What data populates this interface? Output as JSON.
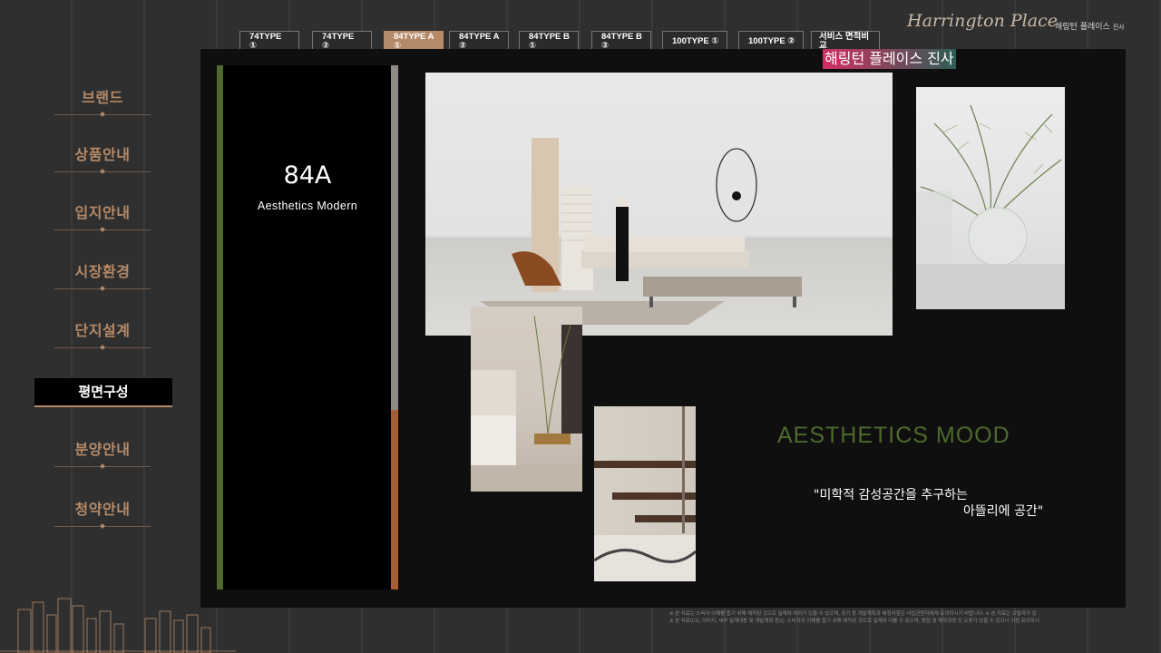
{
  "sidebar": {
    "items": [
      {
        "label": "브랜드"
      },
      {
        "label": "상품안내"
      },
      {
        "label": "입지안내"
      },
      {
        "label": "시장환경"
      },
      {
        "label": "단지설계"
      },
      {
        "label": "평면구성",
        "active": true
      },
      {
        "label": "분양안내"
      },
      {
        "label": "청약안내"
      }
    ]
  },
  "tabs": [
    {
      "line1": "74TYPE",
      "line2": "①"
    },
    {
      "line1": "74TYPE",
      "line2": "②"
    },
    {
      "line1": "84TYPE A",
      "line2": "①",
      "active": true
    },
    {
      "line1": "84TYPE A",
      "line2": "②"
    },
    {
      "line1": "84TYPE B",
      "line2": "①"
    },
    {
      "line1": "84TYPE B",
      "line2": "②"
    },
    {
      "line1": "100TYPE ①"
    },
    {
      "line1": "100TYPE ②"
    },
    {
      "line1": "서비스 면적비",
      "line2": "교"
    }
  ],
  "logo": {
    "script": "Harrington Place",
    "korean": "해링턴 플레이스",
    "small": "진사"
  },
  "overlay_badge": "해링턴 플레이스 진사",
  "type_card": {
    "title": "84A",
    "subtitle": "Aesthetics Modern"
  },
  "mood": {
    "title": "AESTHETICS MOOD",
    "quote_line1": "\"미학적 감성공간을 추구하는",
    "quote_line2": "아뜰리에 공간\""
  },
  "disclaimer": {
    "line1": "※ 본 자료는 소비자 이해를 돕기 위해 제작된 것으로 실제와 차이가 있을 수 있으며, 공기 등 개발계획과 예정사항은 사업관련자에게 유의하시기 바랍니다.  ※ 본 자료는 오탈자가 있",
    "line2": "※ 본 자료(CG, 이미지, 세부 설계내용 및 개발계획 등)는 소비자의 이해를 돕기 위해 제작된 것으로 실제와 다를 수 있으며, 편집 및 제작과정 상 오류가 있을 수 있으니 이점 유의하시"
  },
  "colors": {
    "accent_brown": "#b58a68",
    "accent_green": "#4d6a2c",
    "panel_bg": "#0f0f0f",
    "page_bg": "#2e2e2e"
  }
}
